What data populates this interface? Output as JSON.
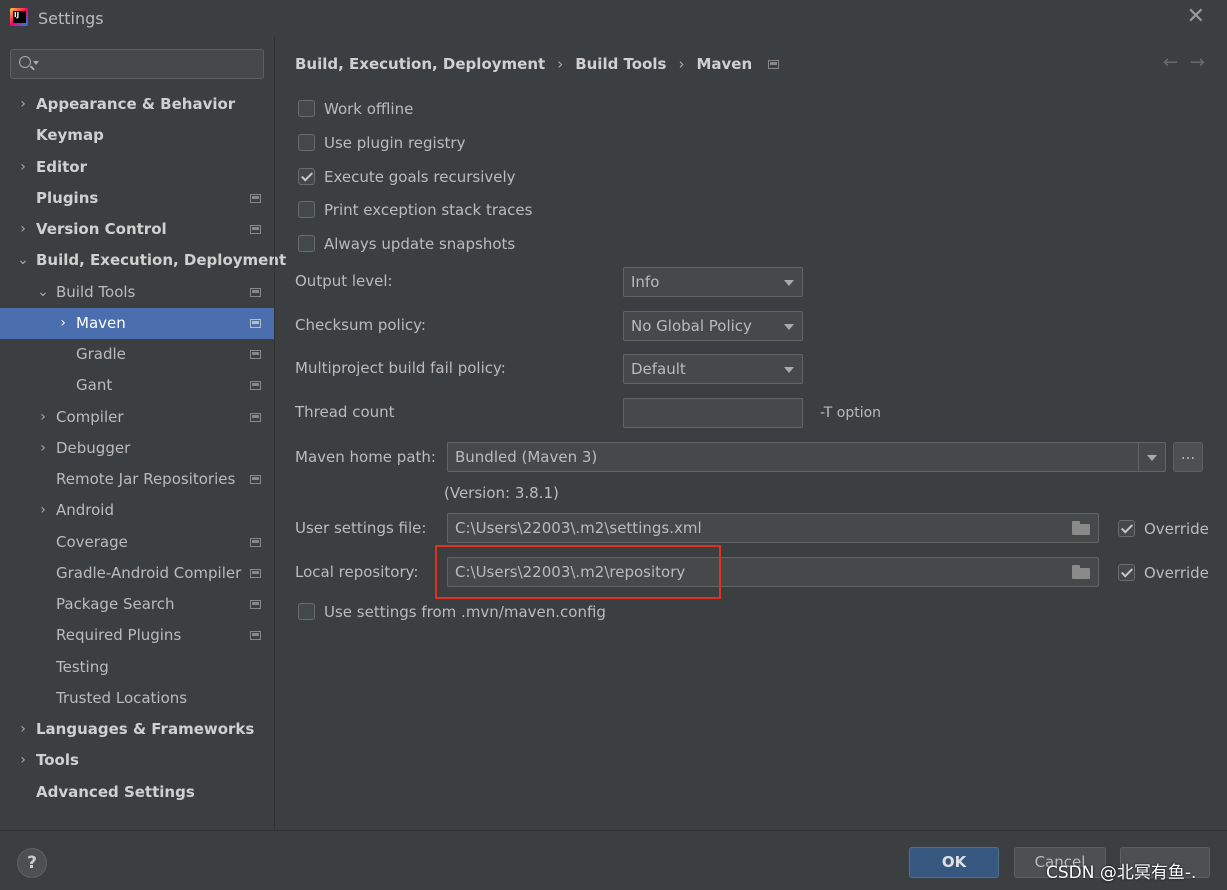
{
  "window": {
    "title": "Settings"
  },
  "search": {
    "placeholder": ""
  },
  "sidebar": {
    "items": [
      {
        "label": "Appearance & Behavior",
        "bold": true,
        "chev": "›",
        "indent": 0,
        "proj": false,
        "selected": false
      },
      {
        "label": "Keymap",
        "bold": true,
        "chev": "",
        "indent": 0,
        "proj": false,
        "selected": false
      },
      {
        "label": "Editor",
        "bold": true,
        "chev": "›",
        "indent": 0,
        "proj": false,
        "selected": false
      },
      {
        "label": "Plugins",
        "bold": true,
        "chev": "",
        "indent": 0,
        "proj": true,
        "selected": false
      },
      {
        "label": "Version Control",
        "bold": true,
        "chev": "›",
        "indent": 0,
        "proj": true,
        "selected": false
      },
      {
        "label": "Build, Execution, Deployment",
        "bold": true,
        "chev": "⌄",
        "indent": 0,
        "proj": false,
        "selected": false
      },
      {
        "label": "Build Tools",
        "bold": false,
        "chev": "⌄",
        "indent": 1,
        "proj": true,
        "selected": false
      },
      {
        "label": "Maven",
        "bold": false,
        "chev": "›",
        "indent": 2,
        "proj": true,
        "selected": true
      },
      {
        "label": "Gradle",
        "bold": false,
        "chev": "",
        "indent": 2,
        "proj": true,
        "selected": false
      },
      {
        "label": "Gant",
        "bold": false,
        "chev": "",
        "indent": 2,
        "proj": true,
        "selected": false
      },
      {
        "label": "Compiler",
        "bold": false,
        "chev": "›",
        "indent": 1,
        "proj": true,
        "selected": false
      },
      {
        "label": "Debugger",
        "bold": false,
        "chev": "›",
        "indent": 1,
        "proj": false,
        "selected": false
      },
      {
        "label": "Remote Jar Repositories",
        "bold": false,
        "chev": "",
        "indent": 1,
        "proj": true,
        "selected": false
      },
      {
        "label": "Android",
        "bold": false,
        "chev": "›",
        "indent": 1,
        "proj": false,
        "selected": false
      },
      {
        "label": "Coverage",
        "bold": false,
        "chev": "",
        "indent": 1,
        "proj": true,
        "selected": false
      },
      {
        "label": "Gradle-Android Compiler",
        "bold": false,
        "chev": "",
        "indent": 1,
        "proj": true,
        "selected": false
      },
      {
        "label": "Package Search",
        "bold": false,
        "chev": "",
        "indent": 1,
        "proj": true,
        "selected": false
      },
      {
        "label": "Required Plugins",
        "bold": false,
        "chev": "",
        "indent": 1,
        "proj": true,
        "selected": false
      },
      {
        "label": "Testing",
        "bold": false,
        "chev": "",
        "indent": 1,
        "proj": false,
        "selected": false
      },
      {
        "label": "Trusted Locations",
        "bold": false,
        "chev": "",
        "indent": 1,
        "proj": false,
        "selected": false
      },
      {
        "label": "Languages & Frameworks",
        "bold": true,
        "chev": "›",
        "indent": 0,
        "proj": false,
        "selected": false
      },
      {
        "label": "Tools",
        "bold": true,
        "chev": "›",
        "indent": 0,
        "proj": false,
        "selected": false
      },
      {
        "label": "Advanced Settings",
        "bold": true,
        "chev": "",
        "indent": 0,
        "proj": false,
        "selected": false
      }
    ]
  },
  "breadcrumb": {
    "part1": "Build, Execution, Deployment",
    "part2": "Build Tools",
    "part3": "Maven",
    "sep": "›"
  },
  "nav": {
    "arrows": "←→"
  },
  "checkboxes": [
    {
      "label": "Work offline",
      "checked": false
    },
    {
      "label": "Use plugin registry",
      "checked": false
    },
    {
      "label": "Execute goals recursively",
      "checked": true
    },
    {
      "label": "Print exception stack traces",
      "checked": false
    },
    {
      "label": "Always update snapshots",
      "checked": false
    }
  ],
  "form": {
    "output_level": {
      "label": "Output level:",
      "value": "Info"
    },
    "checksum_policy": {
      "label": "Checksum policy:",
      "value": "No Global Policy"
    },
    "multiproject_fail": {
      "label": "Multiproject build fail policy:",
      "value": "Default"
    },
    "thread_count": {
      "label": "Thread count",
      "value": "",
      "suffix": "-T option"
    },
    "maven_home": {
      "label": "Maven home path:",
      "value": "Bundled (Maven 3)",
      "browse": "...",
      "version": "(Version: 3.8.1)"
    },
    "user_settings": {
      "label": "User settings file:",
      "value": "C:\\Users\\22003\\.m2\\settings.xml",
      "override_label": "Override",
      "override": true
    },
    "local_repo": {
      "label": "Local repository:",
      "value": "C:\\Users\\22003\\.m2\\repository",
      "override_label": "Override",
      "override": true
    },
    "mvn_config": {
      "label": "Use settings from .mvn/maven.config",
      "checked": false
    }
  },
  "footer": {
    "help": "?",
    "ok": "OK",
    "cancel": "Cancel",
    "apply": "",
    "watermark": "CSDN @北冥有鱼-."
  },
  "colors": {
    "accent": "#4b6eaf",
    "highlight": "#e0301e",
    "ok_button": "#365880"
  }
}
